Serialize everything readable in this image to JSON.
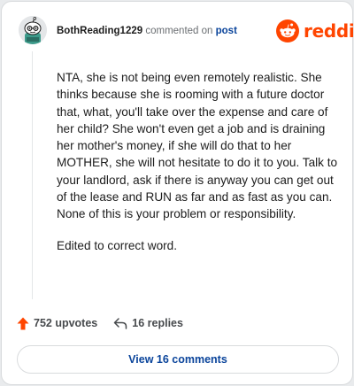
{
  "header": {
    "username": "BothReading1229",
    "action_text": "commented on",
    "target": "post"
  },
  "logo": {
    "wordmark": "reddit",
    "icon": "reddit-snoo-icon",
    "brand_color": "#ff4500"
  },
  "comment": {
    "paragraphs": [
      "NTA, she is not being even remotely realistic. She thinks because she is rooming with a future doctor that, what, you'll take over the expense and care of her child? She won't even get a job and is draining her mother's money, if she will do that to her MOTHER, she will not hesitate to do it to you. Talk to your landlord, ask if there is anyway you can get out of the lease and RUN as far and as fast as you can. None of this is your problem or responsibility.",
      "Edited to correct word."
    ]
  },
  "actions": {
    "upvotes": "752 upvotes",
    "upvote_icon": "upvote-arrow-icon",
    "replies": "16 replies",
    "reply_icon": "reply-arrow-icon"
  },
  "footer": {
    "view_comments": "View 16 comments"
  },
  "colors": {
    "accent": "#ff4500",
    "link": "#0a449b",
    "muted": "#6a6e72"
  }
}
